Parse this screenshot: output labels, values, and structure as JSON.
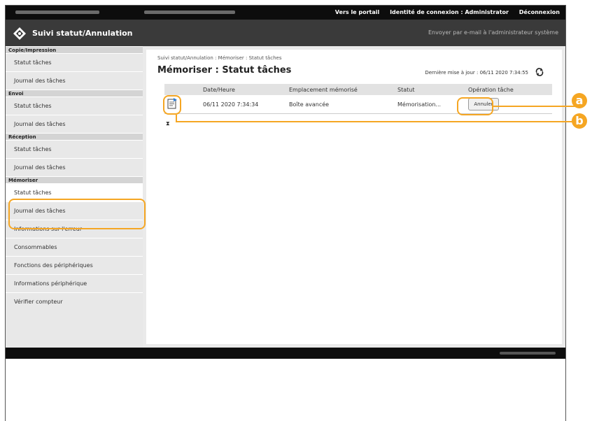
{
  "topbar": {
    "portal_link": "Vers le portail",
    "login_id_label": "Identité de connexion : Administrator",
    "logout_link": "Déconnexion"
  },
  "header": {
    "title": "Suivi statut/Annulation",
    "email_link": "Envoyer par e-mail à l'administrateur système"
  },
  "sidebar": {
    "groups": [
      {
        "heading": "Copie/Impression",
        "items": [
          "Statut tâches",
          "Journal des tâches"
        ]
      },
      {
        "heading": "Envoi",
        "items": [
          "Statut tâches",
          "Journal des tâches"
        ]
      },
      {
        "heading": "Réception",
        "items": [
          "Statut tâches",
          "Journal des tâches"
        ]
      },
      {
        "heading": "Mémoriser",
        "items": [
          "Statut tâches",
          "Journal des tâches"
        ]
      }
    ],
    "extra_items": [
      "Informations sur l'erreur",
      "Consommables",
      "Fonctions des périphériques",
      "Informations périphérique",
      "Vérifier compteur"
    ]
  },
  "main": {
    "breadcrumb": "Suivi statut/Annulation : Mémoriser : Statut tâches",
    "title": "Mémoriser : Statut tâches",
    "last_update": "Dernière mise à jour : 06/11 2020 7:34:55",
    "table": {
      "headers": [
        "Date/Heure",
        "Emplacement mémorisé",
        "Statut",
        "Opération tâche"
      ],
      "rows": [
        {
          "datetime": "06/11 2020 7:34:34",
          "location": "Boîte avancée",
          "status": "Mémorisation...",
          "action": "Annuler"
        }
      ]
    },
    "pager_icon": "pager-icon"
  },
  "annotations": {
    "a": "a",
    "b": "b"
  },
  "colors": {
    "callout": "#f5a623",
    "header": "#3a3a3a",
    "topbar": "#0d0d0d"
  }
}
